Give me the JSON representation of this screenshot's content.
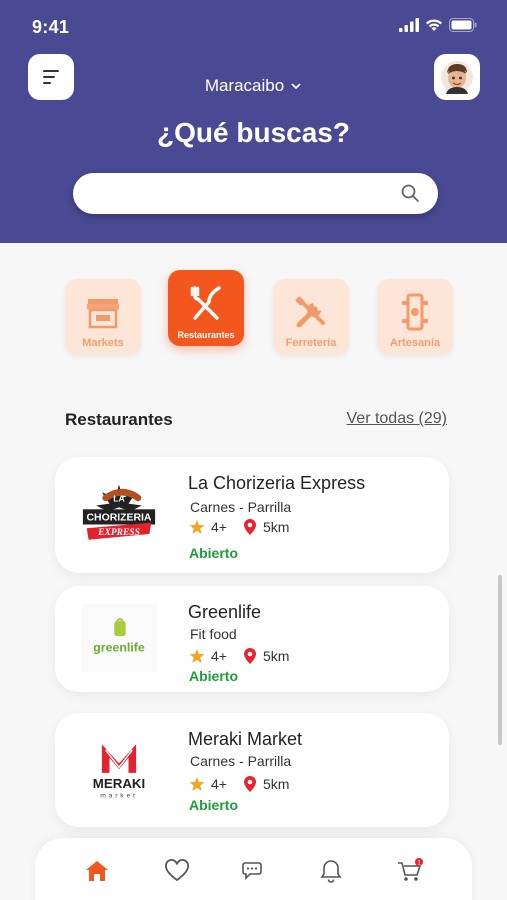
{
  "status_bar": {
    "time": "9:41"
  },
  "header": {
    "city": "Maracaibo",
    "title": "¿Qué buscas?",
    "search_placeholder": ""
  },
  "categories": [
    {
      "label": "Markets",
      "icon": "market-stall-icon",
      "active": false
    },
    {
      "label": "Restaurantes",
      "icon": "fork-knife-icon",
      "active": true
    },
    {
      "label": "Ferretería",
      "icon": "tools-icon",
      "active": false
    },
    {
      "label": "Artesanía",
      "icon": "craft-icon",
      "active": false
    }
  ],
  "section": {
    "title": "Restaurantes",
    "see_all": "Ver todas (29)"
  },
  "restaurants": [
    {
      "name": "La Chorizeria Express",
      "category": "Carnes - Parrilla",
      "rating": "4+",
      "distance": "5km",
      "status": "Abierto"
    },
    {
      "name": "Greenlife",
      "category": "Fit food",
      "rating": "4+",
      "distance": "5km",
      "status": "Abierto"
    },
    {
      "name": "Meraki  Market",
      "category": "Carnes - Parrilla",
      "rating": "4+",
      "distance": "5km",
      "status": "Abierto"
    }
  ],
  "logos": {
    "chorizeria_line1": "LA",
    "chorizeria_line2": "CHORIZERIA",
    "chorizeria_line3": "EXPRESS",
    "greenlife": "greenlife",
    "meraki": "MERAKI",
    "meraki_sub": "market"
  },
  "bottom_nav": {
    "items": [
      "home-icon",
      "heart-icon",
      "chat-icon",
      "bell-icon",
      "cart-icon"
    ],
    "cart_badge": "1"
  },
  "colors": {
    "header_bg": "#4a4a94",
    "accent": "#f4571d",
    "category_bg": "#fde6d8",
    "open_green": "#1f9d3a"
  }
}
